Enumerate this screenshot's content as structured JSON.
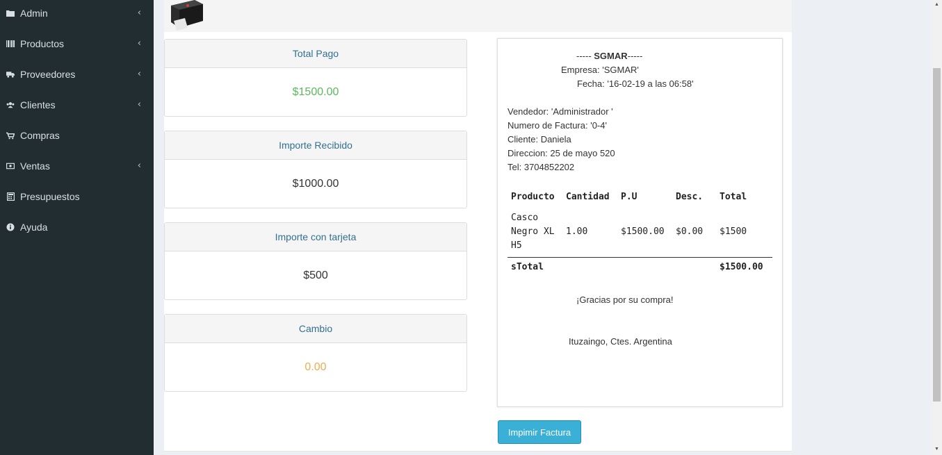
{
  "sidebar": {
    "items": [
      {
        "label": "Admin",
        "icon": "folder-icon",
        "has_chevron": true
      },
      {
        "label": "Productos",
        "icon": "barcode-icon",
        "has_chevron": true
      },
      {
        "label": "Proveedores",
        "icon": "truck-icon",
        "has_chevron": true
      },
      {
        "label": "Clientes",
        "icon": "users-icon",
        "has_chevron": true
      },
      {
        "label": "Compras",
        "icon": "cart-icon",
        "has_chevron": false
      },
      {
        "label": "Ventas",
        "icon": "money-icon",
        "has_chevron": true
      },
      {
        "label": "Presupuestos",
        "icon": "calculator-icon",
        "has_chevron": false
      },
      {
        "label": "Ayuda",
        "icon": "info-icon",
        "has_chevron": false
      }
    ],
    "chevron": "‹"
  },
  "panels": [
    {
      "title": "Total Pago",
      "value": "$1500.00",
      "color": "#5cb85c"
    },
    {
      "title": "Importe Recibido",
      "value": "$1000.00",
      "color": "#333333"
    },
    {
      "title": "Importe con tarjeta",
      "value": "$500",
      "color": "#333333"
    },
    {
      "title": "Cambio",
      "value": "0.00",
      "color": "#f0ad4e"
    }
  ],
  "invoice": {
    "header_prefix": "----- ",
    "header_name": "SGMAR",
    "header_suffix": "-----",
    "empresa": "Empresa: 'SGMAR'",
    "fecha": "Fecha: '16-02-19 a las 06:58'",
    "vendedor": "Vendedor: 'Administrador '",
    "numero": "Numero de Factura: '0-4'",
    "cliente": "Cliente: Daniela",
    "direccion": "Direccion: 25 de mayo 520",
    "tel": "Tel: 3704852202",
    "table_headers": [
      "Producto",
      "Cantidad",
      "P.U",
      "Desc.",
      "Total"
    ],
    "rows": [
      {
        "producto_lines": [
          "Casco",
          "Negro XL",
          "H5"
        ],
        "cantidad": "1.00",
        "pu": "$1500.00",
        "desc": "$0.00",
        "total": "$1500"
      }
    ],
    "stotal_label": "sTotal",
    "stotal_value": "$1500.00",
    "gracias": "¡Gracias por su compra!",
    "location": "Ituzaingo, Ctes. Argentina"
  },
  "print_button": "Impimir Factura",
  "colors": {
    "sidebar_bg": "#222d32",
    "button_bg": "#3bb0d6",
    "panel_title": "#31708f"
  }
}
